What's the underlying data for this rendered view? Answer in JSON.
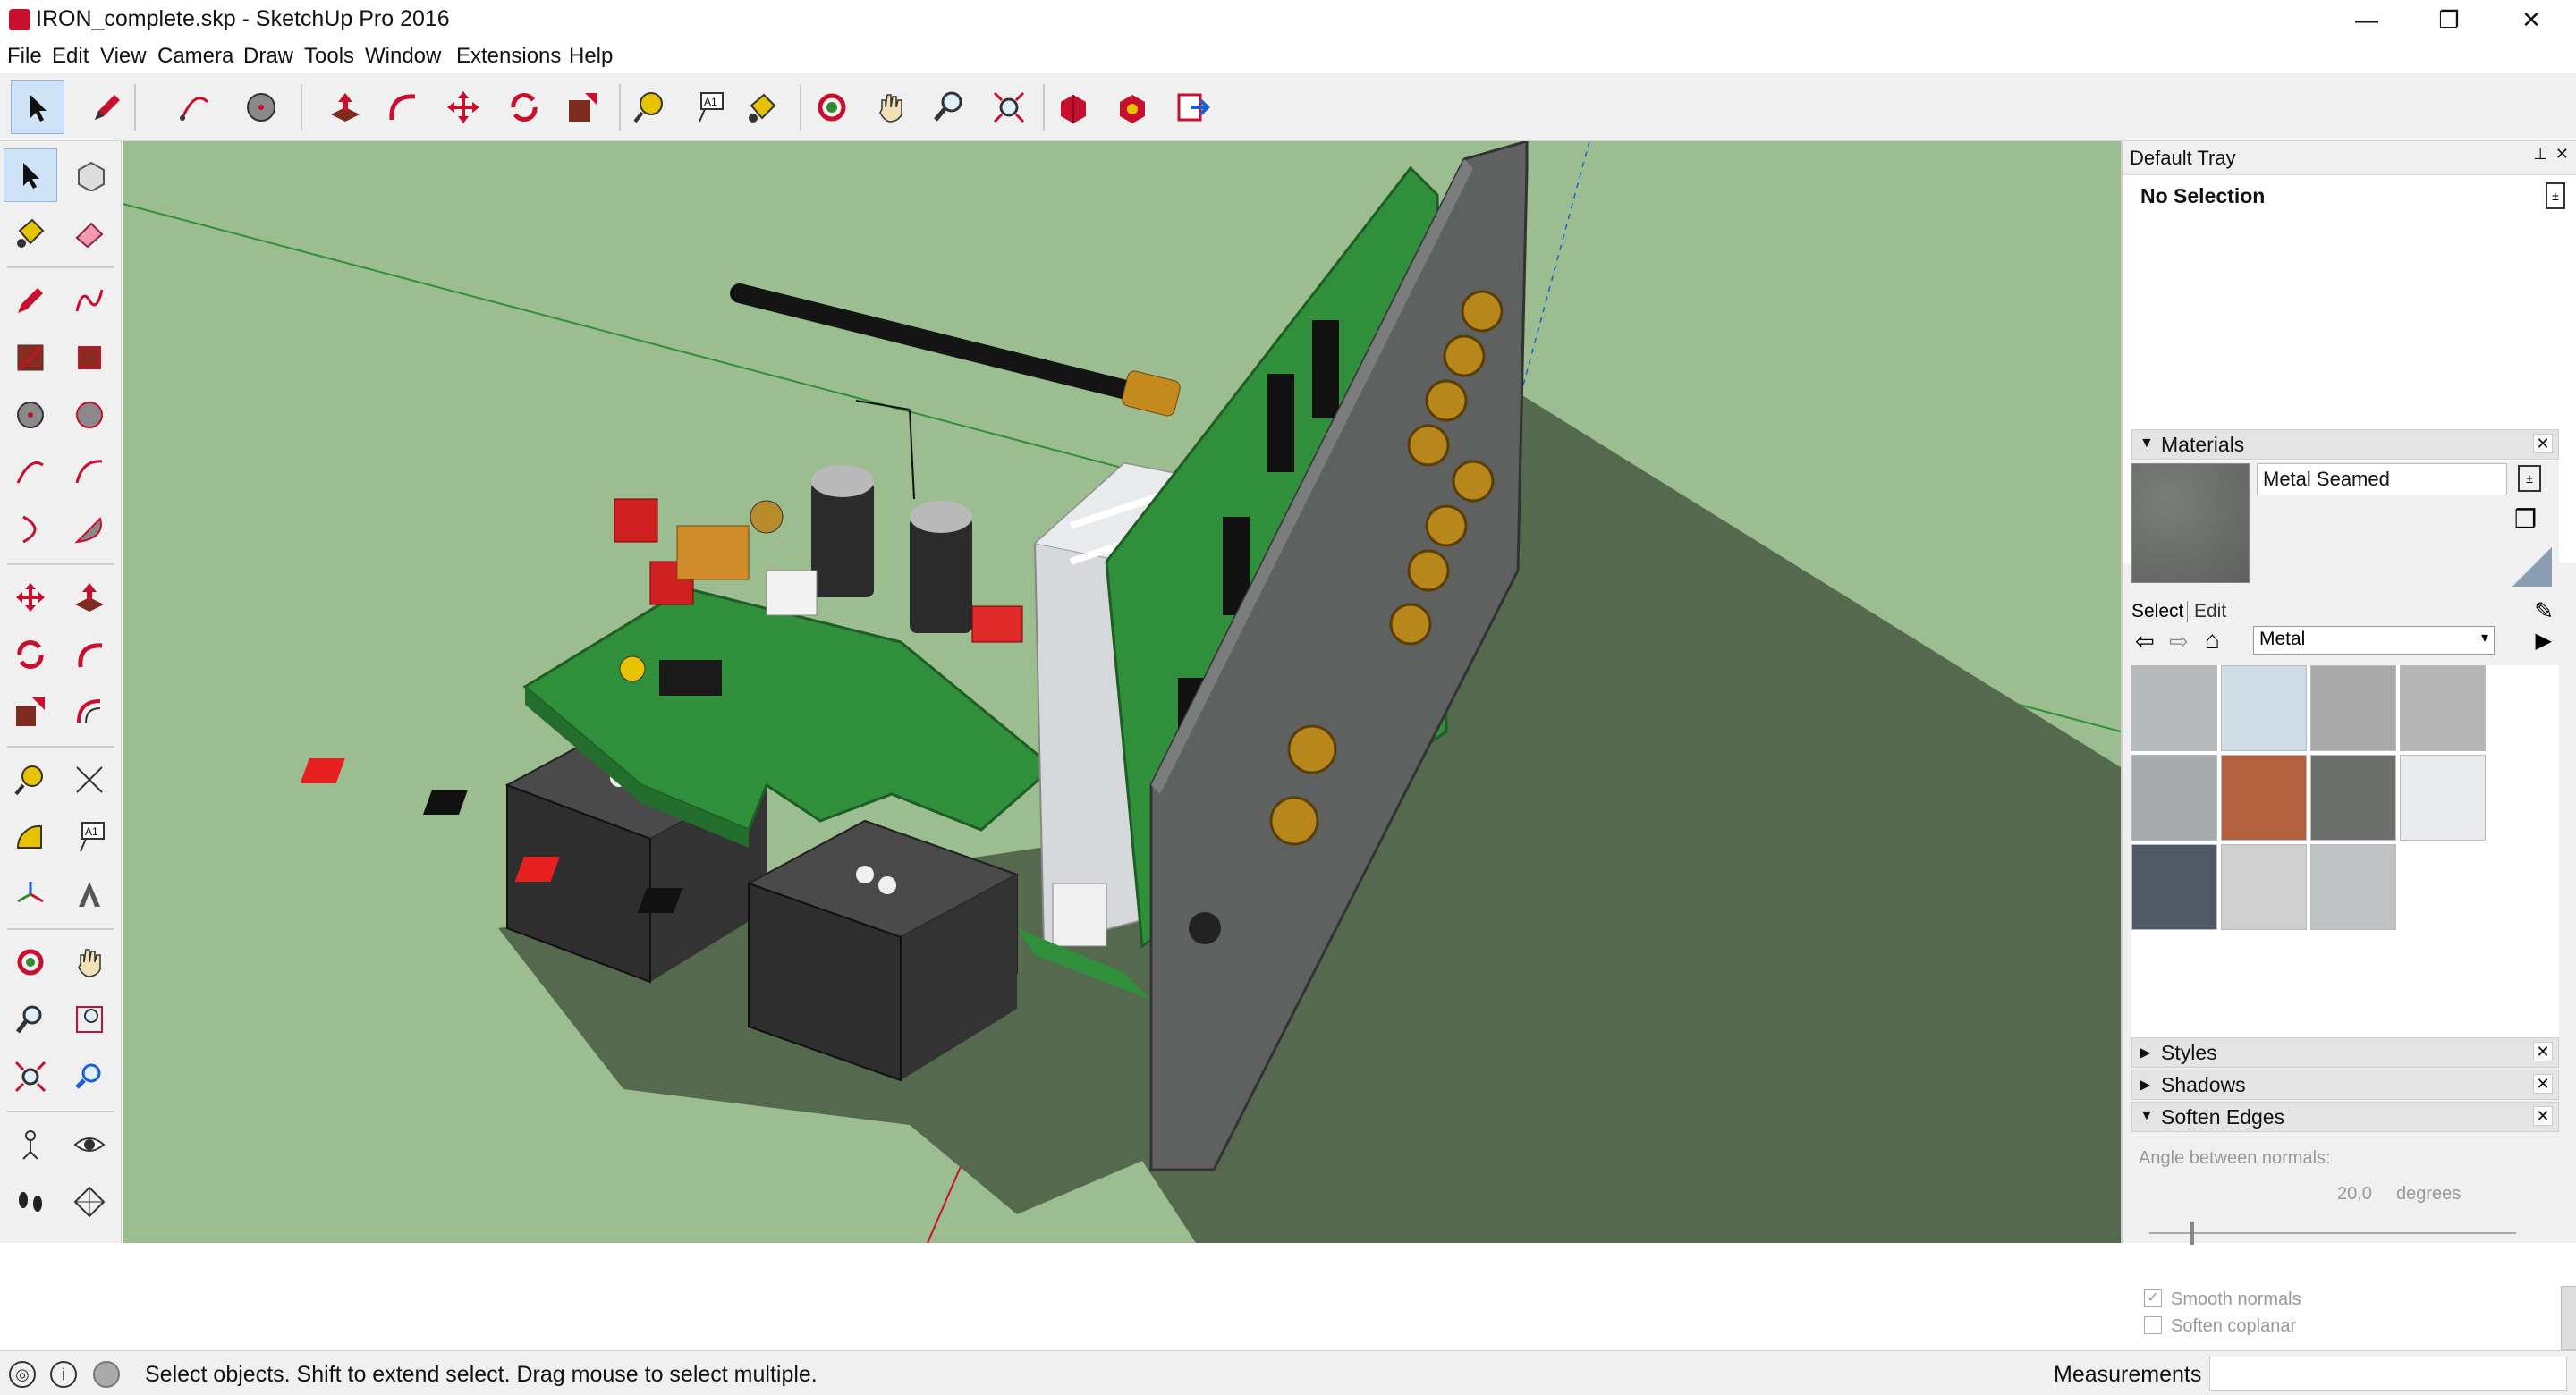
{
  "window": {
    "title": "IRON_complete.skp - SketchUp Pro 2016",
    "controls": {
      "minimize": "—",
      "restore": "❐",
      "close": "✕"
    }
  },
  "menu": [
    "File",
    "Edit",
    "View",
    "Camera",
    "Draw",
    "Tools",
    "Window",
    "Extensions",
    "Help"
  ],
  "toolbar_icons": [
    "select-icon",
    "pencil-icon",
    "arc-icon",
    "circle-icon",
    "push-pull-icon",
    "follow-me-icon",
    "move-icon",
    "rotate-icon",
    "scale-icon",
    "tape-measure-icon",
    "text-icon",
    "paint-bucket-icon",
    "orbit-icon",
    "pan-icon",
    "zoom-icon",
    "zoom-extents-icon",
    "3d-warehouse-icon",
    "extension-warehouse-icon",
    "layout-send-icon"
  ],
  "tray": {
    "title": "Default Tray",
    "entity_info": {
      "label": "No Selection"
    },
    "materials": {
      "header": "Materials",
      "material_name": "Metal Seamed",
      "tabs": [
        "Select",
        "Edit"
      ],
      "collection": "Metal",
      "swatch_colors": [
        "#b7b9ba",
        "#cfdde6",
        "#a9a9a9",
        "#b4b5b4",
        "#a6aaad",
        "#b2603e",
        "#6d6f6d",
        "#e8eaee",
        "#4f5865",
        "#cfcfcf",
        "#bfc3c4"
      ]
    },
    "styles": "Styles",
    "shadows": "Shadows",
    "soften": {
      "header": "Soften Edges",
      "angle_label": "Angle between normals:",
      "angle_value": "20,0",
      "unit": "degrees",
      "smooth_label": "Smooth normals",
      "coplanar_label": "Soften coplanar",
      "smooth_checked": true,
      "coplanar_checked": false
    }
  },
  "status": {
    "message": "Select objects. Shift to extend select. Drag mouse to select multiple.",
    "measurements_label": "Measurements",
    "measurements_value": ""
  },
  "colors": {
    "viewport_bg": "#9bbd8f",
    "pcb_green": "#2f8f3a",
    "panel_gray": "#5f6160",
    "connector_gold": "#b8871c"
  }
}
